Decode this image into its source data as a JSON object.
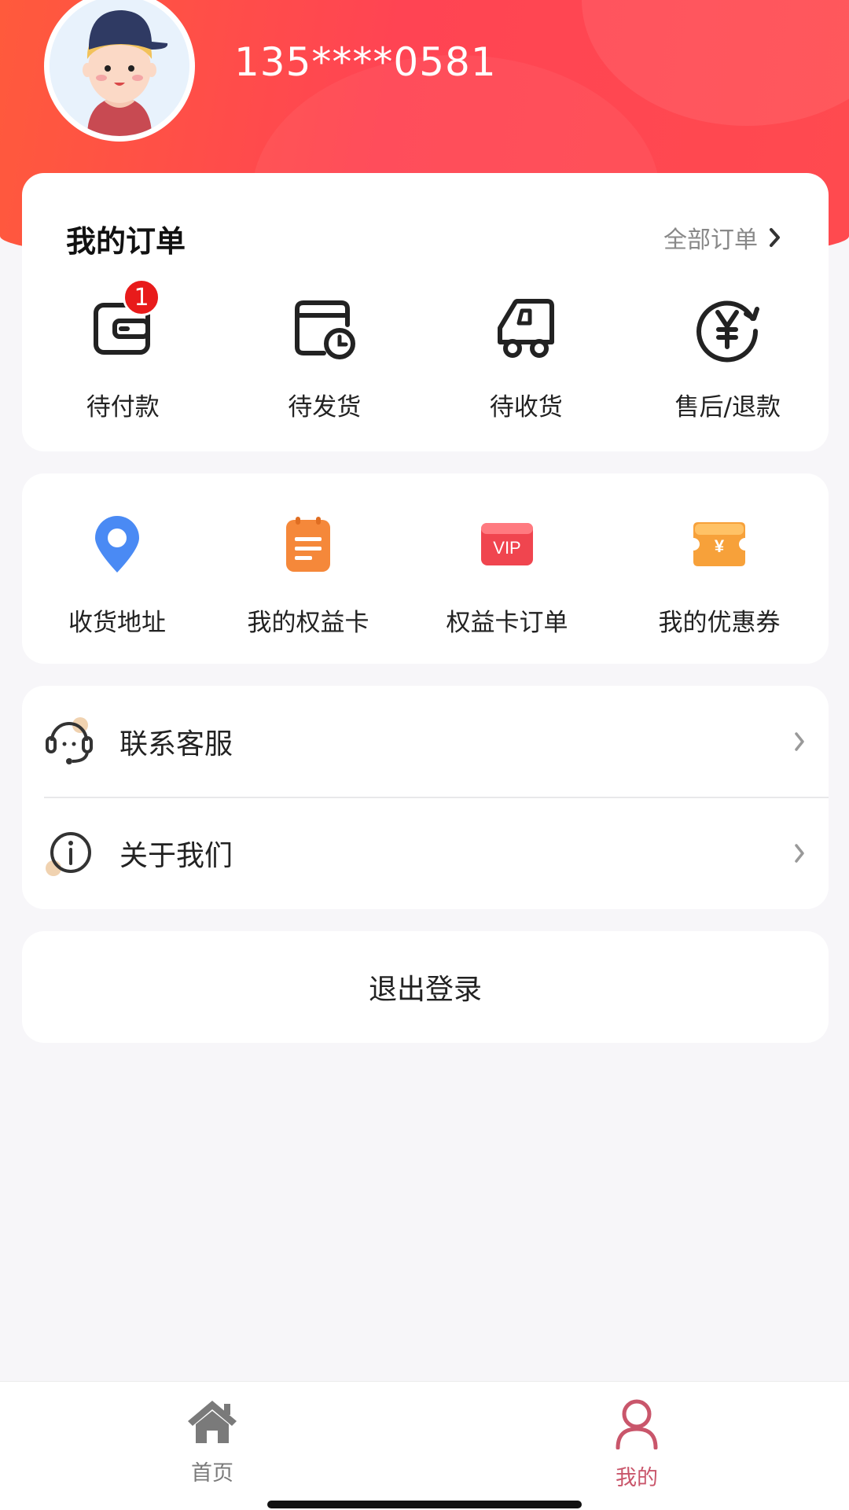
{
  "user": {
    "phone": "135****0581"
  },
  "orders": {
    "title": "我的订单",
    "all_label": "全部订单",
    "items": [
      {
        "label": "待付款",
        "icon": "wallet-icon",
        "badge": "1"
      },
      {
        "label": "待发货",
        "icon": "calendar-clock-icon"
      },
      {
        "label": "待收货",
        "icon": "delivery-truck-icon"
      },
      {
        "label": "售后/退款",
        "icon": "yuan-refund-icon"
      }
    ]
  },
  "tools": {
    "items": [
      {
        "label": "收货地址",
        "icon": "location-pin-icon",
        "color": "#4a8af4"
      },
      {
        "label": "我的权益卡",
        "icon": "notepad-icon",
        "color": "#f5883a"
      },
      {
        "label": "权益卡订单",
        "icon": "vip-icon",
        "color": "#f0454f",
        "icon_text": "VIP"
      },
      {
        "label": "我的优惠券",
        "icon": "coupon-icon",
        "color": "#f7a13a",
        "icon_text": "¥"
      }
    ]
  },
  "menu": {
    "items": [
      {
        "label": "联系客服",
        "icon": "headset-icon"
      },
      {
        "label": "关于我们",
        "icon": "info-icon"
      }
    ]
  },
  "logout_label": "退出登录",
  "tabbar": {
    "items": [
      {
        "label": "首页",
        "icon": "home-icon",
        "active": false
      },
      {
        "label": "我的",
        "icon": "user-icon",
        "active": true
      }
    ],
    "active_color": "#c9566b",
    "inactive_color": "#7a7a7a"
  },
  "colors": {
    "header_gradient_start": "#ff5a3c",
    "header_gradient_end": "#ff4a4f",
    "badge": "#e81b1b"
  }
}
